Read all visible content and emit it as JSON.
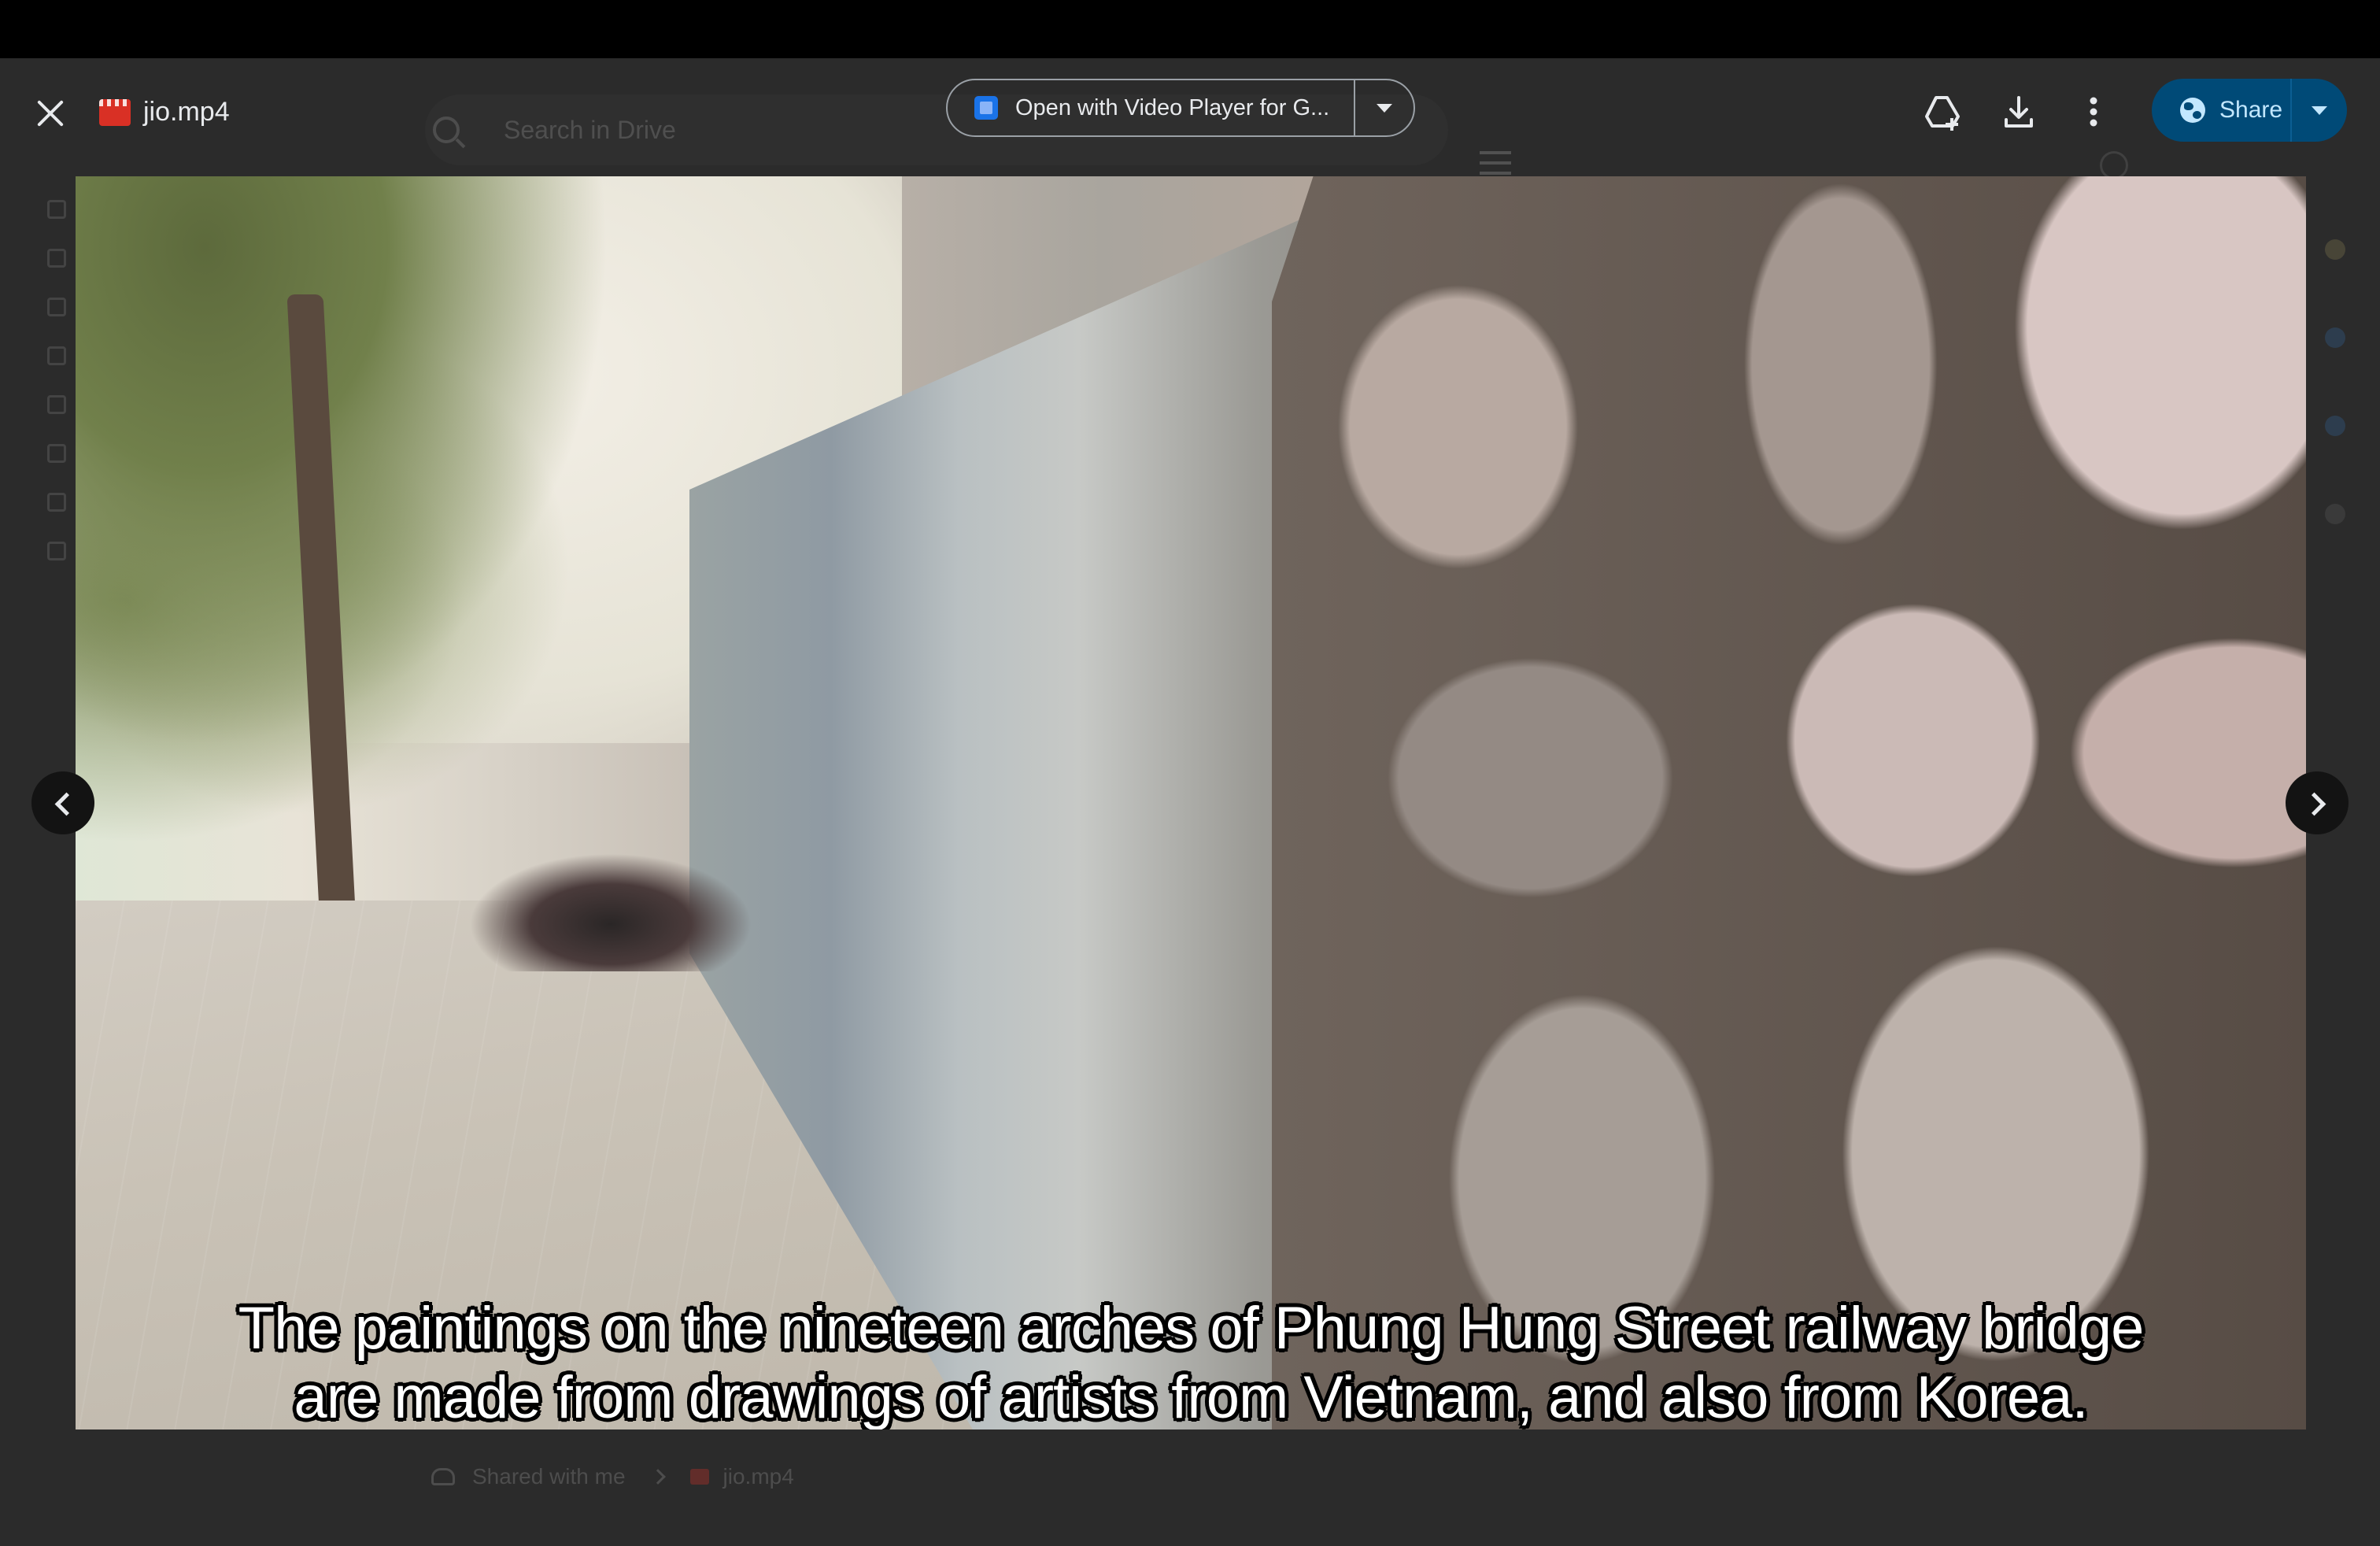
{
  "header": {
    "file_name": "jio.mp4",
    "open_with_label": "Open with Video Player for G...",
    "share_label": "Share"
  },
  "background": {
    "search_placeholder": "Search in Drive",
    "breadcrumb": [
      "Shared with me",
      "jio.mp4"
    ]
  },
  "video": {
    "subtitle_lines": [
      "The paintings on the nineteen arches of Phung Hung Street railway bridge",
      "are made from drawings of artists from Vietnam, and also from Korea."
    ]
  },
  "icons": {
    "close": "close-icon",
    "file": "video-file-icon",
    "open_with_app": "video-player-app-icon",
    "add_shortcut": "add-to-drive-icon",
    "download": "download-icon",
    "more": "more-vert-icon",
    "share_globe": "globe-icon",
    "previous": "chevron-left-icon",
    "next": "chevron-right-icon"
  },
  "colors": {
    "share_button_bg": "#004a77",
    "share_button_text": "#c2e7ff",
    "viewer_bg": "#2b2b2b",
    "file_icon": "#d93025"
  }
}
